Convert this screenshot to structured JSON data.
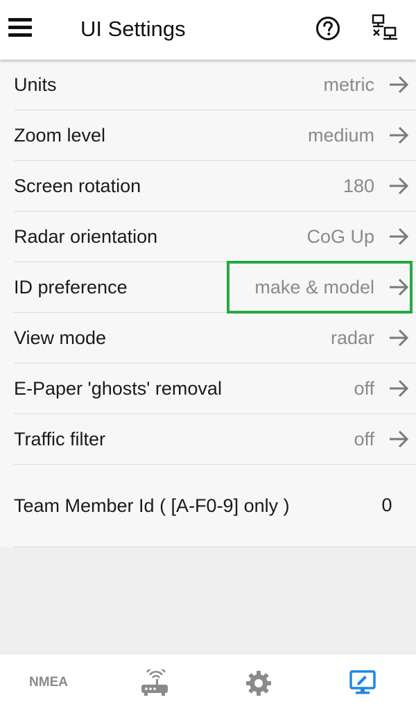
{
  "header": {
    "title": "UI Settings",
    "menu_icon": "hamburger-menu-icon",
    "help_icon": "help-circle-icon",
    "network_icon": "network-disconnected-icon"
  },
  "settings": [
    {
      "label": "Units",
      "value": "metric"
    },
    {
      "label": "Zoom level",
      "value": "medium"
    },
    {
      "label": "Screen rotation",
      "value": "180"
    },
    {
      "label": "Radar orientation",
      "value": "CoG Up"
    },
    {
      "label": "ID preference",
      "value": "make & model"
    },
    {
      "label": "View mode",
      "value": "radar"
    },
    {
      "label": "E-Paper 'ghosts' removal",
      "value": "off"
    },
    {
      "label": "Traffic filter",
      "value": "off"
    }
  ],
  "team": {
    "label": "Team Member Id  ( [A-F0-9] only )",
    "value": "0"
  },
  "bottom_nav": {
    "nmea_label": "NMEA",
    "items": [
      "NMEA",
      "router-icon",
      "gear-icon",
      "display-edit-icon"
    ],
    "active_index": 3
  },
  "colors": {
    "accent": "#1e88e5",
    "highlight": "#24a944",
    "inactive": "#8a8a8a"
  }
}
